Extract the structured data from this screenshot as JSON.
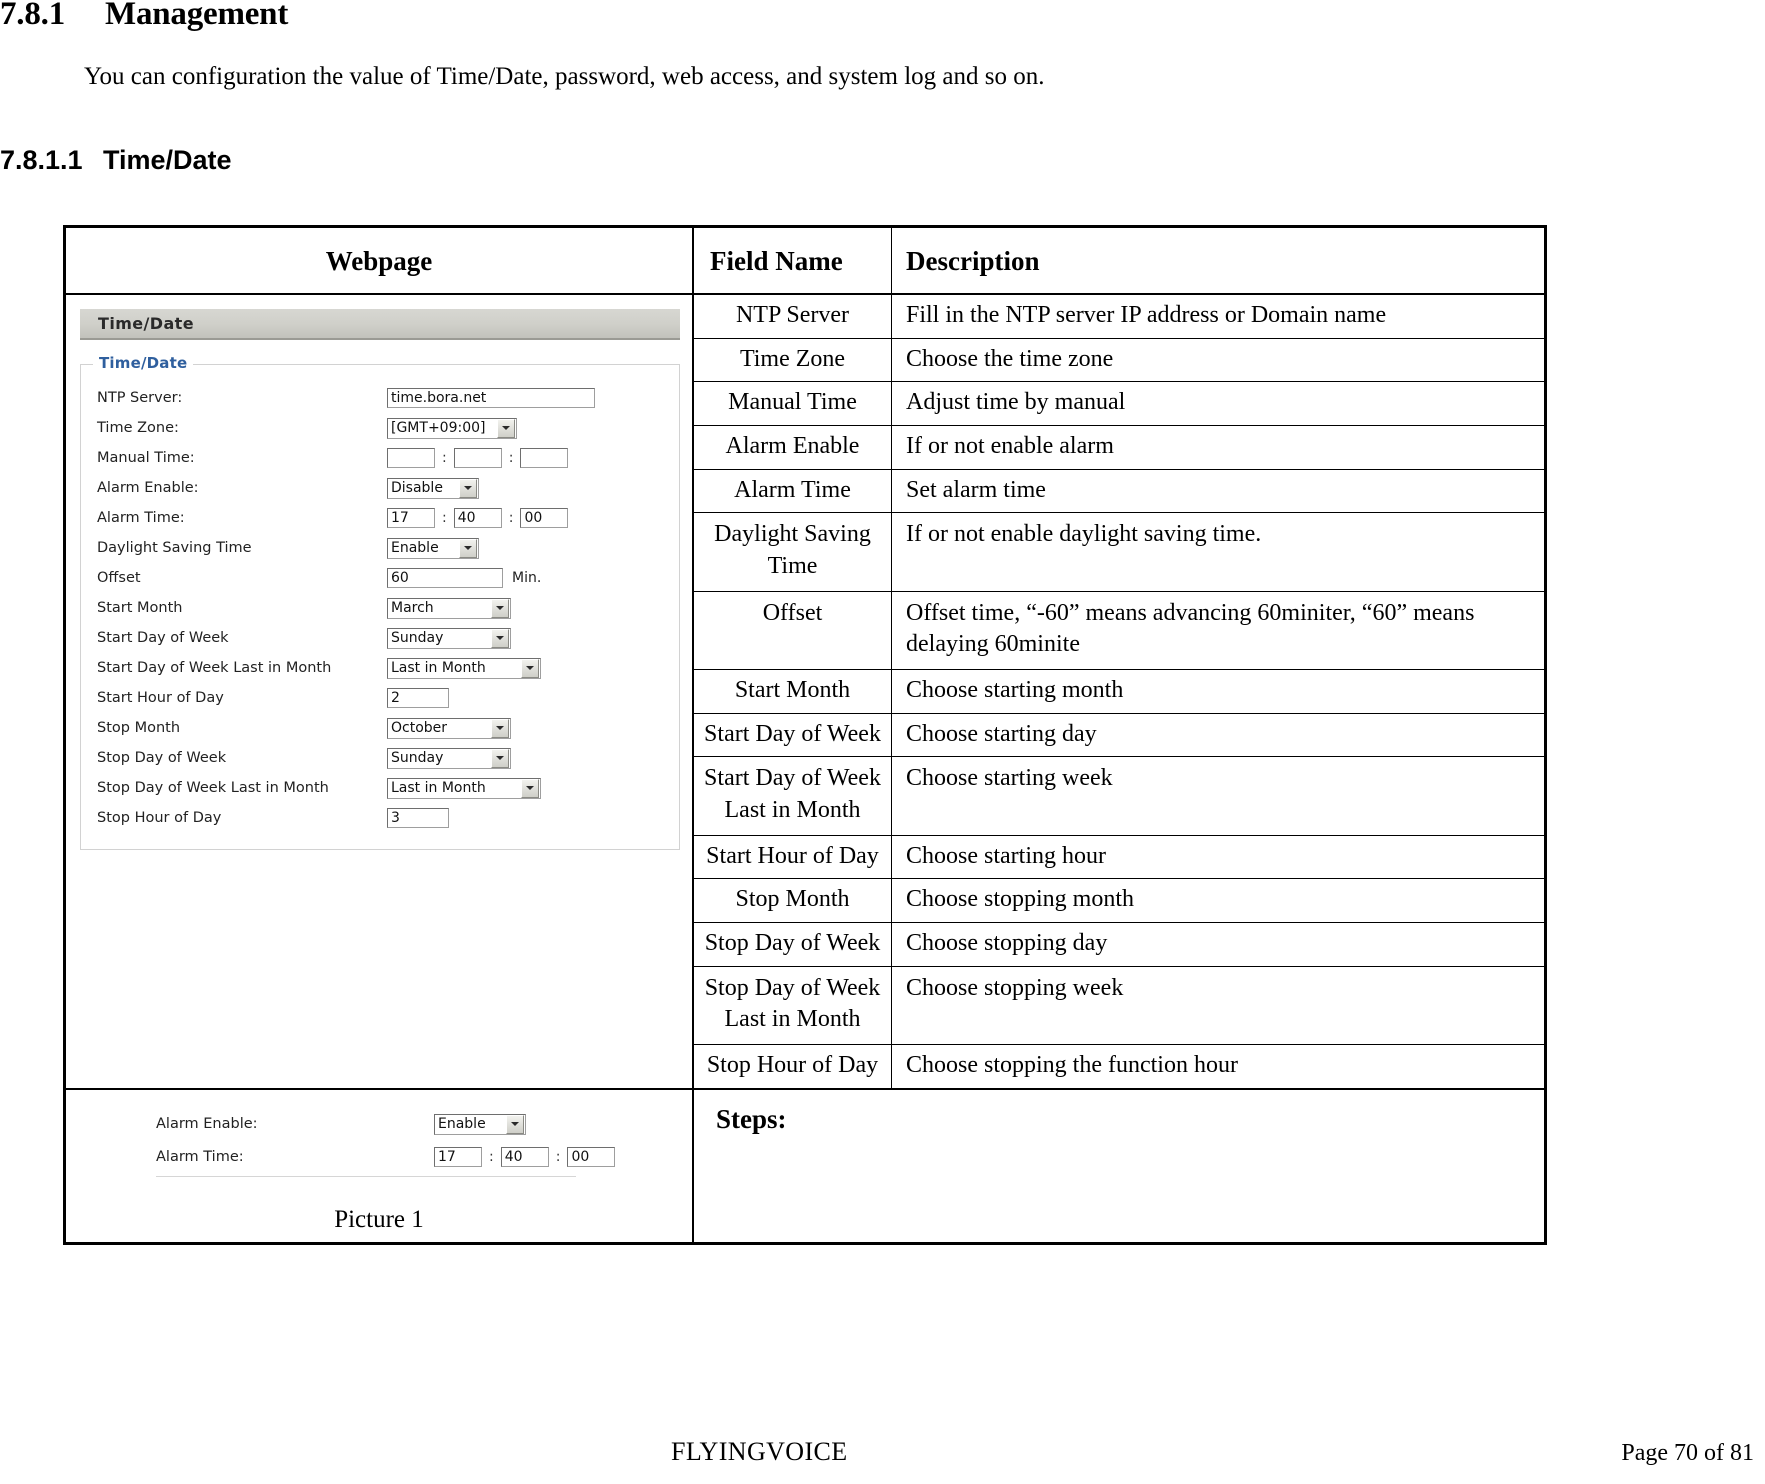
{
  "document": {
    "section_number": "7.8.1",
    "section_title": "Management",
    "intro_paragraph": "You can configuration the value of Time/Date, password, web access, and system log and so on.",
    "subsection_number": "7.8.1.1",
    "subsection_title": "Time/Date"
  },
  "table": {
    "headers": {
      "webpage": "Webpage",
      "field_name": "Field Name",
      "description": "Description"
    },
    "rows": [
      {
        "field": "NTP Server",
        "description": "Fill in the NTP server IP address or Domain name"
      },
      {
        "field": "Time Zone",
        "description": "Choose the time zone"
      },
      {
        "field": "Manual Time",
        "description": "Adjust time by manual"
      },
      {
        "field": "Alarm Enable",
        "description": "If or not enable alarm"
      },
      {
        "field": "Alarm Time",
        "description": "Set alarm time"
      },
      {
        "field": "Daylight Saving Time",
        "description": "If or not enable daylight saving time."
      },
      {
        "field": "Offset",
        "description": "Offset time, “-60” means advancing 60miniter, “60” means delaying 60minite"
      },
      {
        "field": "Start Month",
        "description": "Choose starting month"
      },
      {
        "field": "Start Day of Week",
        "description": "Choose starting day"
      },
      {
        "field": "Start Day of Week Last in Month",
        "description": "Choose starting week"
      },
      {
        "field": "Start Hour of Day",
        "description": "Choose starting hour"
      },
      {
        "field": "Stop Month",
        "description": "Choose stopping month"
      },
      {
        "field": "Stop Day of Week",
        "description": "Choose stopping day"
      },
      {
        "field": "Stop Day of Week Last in Month",
        "description": "Choose stopping week"
      },
      {
        "field": "Stop Hour of Day",
        "description": "Choose stopping the function hour"
      }
    ],
    "steps_label": "Steps:",
    "picture_caption": "Picture 1"
  },
  "screenshot": {
    "window_title": "Time/Date",
    "group_legend": "Time/Date",
    "fields": [
      {
        "label": "NTP Server:",
        "type": "text",
        "value": "time.bora.net"
      },
      {
        "label": "Time Zone:",
        "type": "select",
        "value": "[GMT+09:00]"
      },
      {
        "label": "Manual Time:",
        "type": "time",
        "hour": "",
        "minute": "",
        "second": ""
      },
      {
        "label": "Alarm Enable:",
        "type": "select",
        "value": "Disable"
      },
      {
        "label": "Alarm Time:",
        "type": "time",
        "hour": "17",
        "minute": "40",
        "second": "00"
      },
      {
        "label": "Daylight Saving Time",
        "type": "select",
        "value": "Enable"
      },
      {
        "label": "Offset",
        "type": "text",
        "value": "60",
        "unit": "Min."
      },
      {
        "label": "Start Month",
        "type": "select",
        "value": "March"
      },
      {
        "label": "Start Day of Week",
        "type": "select",
        "value": "Sunday"
      },
      {
        "label": "Start Day of Week Last in Month",
        "type": "select",
        "value": "Last in Month"
      },
      {
        "label": "Start Hour of Day",
        "type": "text",
        "value": "2"
      },
      {
        "label": "Stop Month",
        "type": "select",
        "value": "October"
      },
      {
        "label": "Stop Day of Week",
        "type": "select",
        "value": "Sunday"
      },
      {
        "label": "Stop Day of Week Last in Month",
        "type": "select",
        "value": "Last in Month"
      },
      {
        "label": "Stop Hour of Day",
        "type": "text",
        "value": "3"
      }
    ],
    "colon_separator": ":"
  },
  "screenshot2": {
    "fields": [
      {
        "label": "Alarm Enable:",
        "type": "select",
        "value": "Enable"
      },
      {
        "label": "Alarm Time:",
        "type": "time",
        "hour": "17",
        "minute": "40",
        "second": "00"
      }
    ]
  },
  "footer": {
    "company": "FLYINGVOICE",
    "page_word": "Page",
    "page_number": "70",
    "of_word": "of",
    "total_pages": "81"
  }
}
